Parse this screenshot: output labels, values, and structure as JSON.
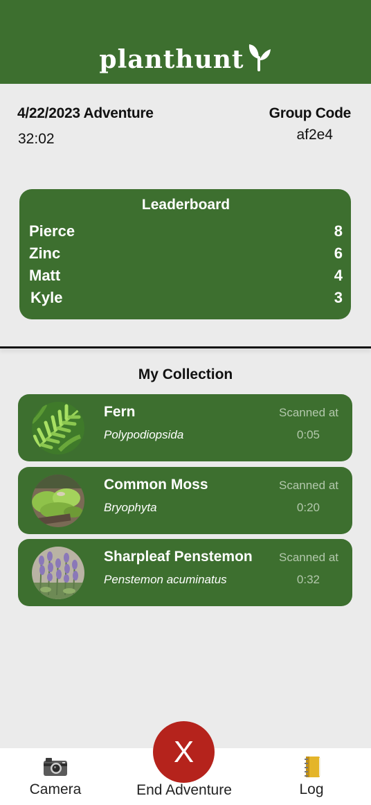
{
  "app": {
    "brand": "planthunt"
  },
  "adventure": {
    "title": "4/22/2023 Adventure",
    "elapsed": "32:02"
  },
  "group": {
    "label": "Group Code",
    "code": "af2e4"
  },
  "leaderboard": {
    "title": "Leaderboard",
    "entries": [
      {
        "name": "Pierce",
        "score": "8"
      },
      {
        "name": "Zinc",
        "score": "6"
      },
      {
        "name": "Matt",
        "score": "4"
      },
      {
        "name": "Kyle",
        "score": "3"
      }
    ]
  },
  "collection": {
    "title": "My Collection",
    "items": [
      {
        "name": "Fern",
        "scientific": "Polypodiopsida",
        "scanned_label": "Scanned at",
        "scanned_time": "0:05"
      },
      {
        "name": "Common Moss",
        "scientific": "Bryophyta",
        "scanned_label": "Scanned at",
        "scanned_time": "0:20"
      },
      {
        "name": "Sharpleaf Penstemon",
        "scientific": "Penstemon acuminatus",
        "scanned_label": "Scanned at",
        "scanned_time": "0:32"
      }
    ]
  },
  "nav": {
    "camera_label": "Camera",
    "camera_icon": "camera-icon",
    "end_label": "End Adventure",
    "end_symbol": "X",
    "log_label": "Log",
    "log_icon": "notebook-icon"
  },
  "colors": {
    "brand_green": "#3d6f2f",
    "end_red": "#b5231c",
    "background": "#ebebeb"
  }
}
